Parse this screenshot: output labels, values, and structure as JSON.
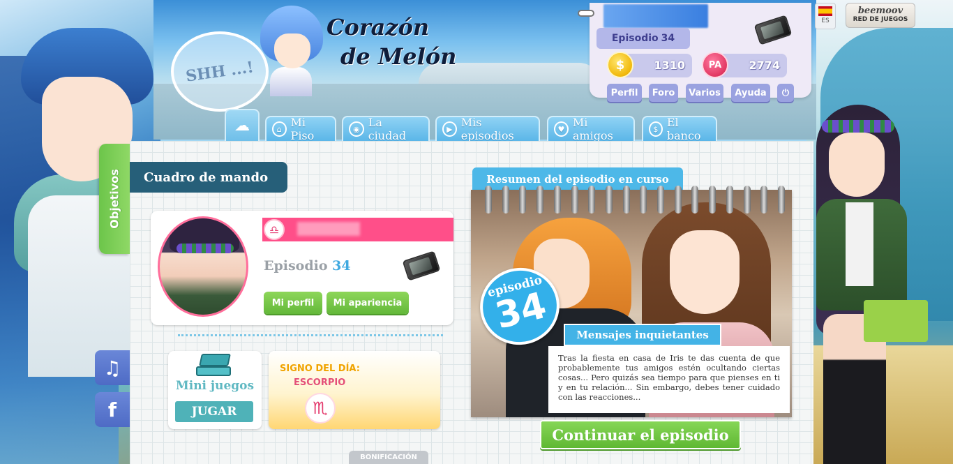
{
  "header": {
    "logo_line1": "Corazón",
    "logo_line2": "de Melón",
    "bubble_text": "SHH ...!"
  },
  "user_panel": {
    "episode_label": "Episodio",
    "episode_number": "34",
    "coins": "1310",
    "coin_symbol": "$",
    "pa_points": "2774",
    "pa_symbol": "PA",
    "buttons": [
      "Perfil",
      "Foro",
      "Varios",
      "Ayuda"
    ],
    "power_symbol": "⏻"
  },
  "language": {
    "code": "ES"
  },
  "beemoov": {
    "brand": "beemoov",
    "label": "RED DE JUEGOS"
  },
  "nav": {
    "tabs": [
      {
        "label": "Mi Piso",
        "icon": "⌂"
      },
      {
        "label": "La ciudad",
        "icon": "◉"
      },
      {
        "label": "Mis episodios",
        "icon": "▶"
      },
      {
        "label": "Mi amigos",
        "icon": "♥"
      },
      {
        "label": "El banco",
        "icon": "$"
      }
    ]
  },
  "sidebar": {
    "objectives_label": "Objetivos",
    "music_symbol": "♫",
    "facebook_symbol": "f"
  },
  "dashboard": {
    "title": "Cuadro de mando",
    "zodiac_symbol": "♎",
    "episode_label": "Episodio",
    "episode_number": "34",
    "btn_profile": "Mi perfil",
    "btn_appearance": "Mi apariencia"
  },
  "minigames": {
    "title": "Mini juegos",
    "play": "JUGAR"
  },
  "horoscope": {
    "title": "SIGNO DEL DÍA:",
    "sign": "ESCORPIO",
    "symbol": "♏"
  },
  "bonus": {
    "label": "BONIFICACIÓN"
  },
  "episode_summary": {
    "title": "Resumen del episodio en curso",
    "badge_word": "episodio",
    "badge_number": "34",
    "name": "Mensajes inquietantes",
    "description": "Tras la fiesta en casa de Iris te das cuenta de que probablemente tus amigos estén ocultando ciertas cosas... Pero quizás sea tiempo para que pienses en ti y en tu relación... Sin embargo, debes tener cuidado con las reacciones...",
    "continue": "Continuar el episodio"
  },
  "colors": {
    "accent_blue": "#4db8e8",
    "accent_green": "#6cc54a",
    "accent_pink": "#ff4f89",
    "dark_teal": "#265f79"
  }
}
